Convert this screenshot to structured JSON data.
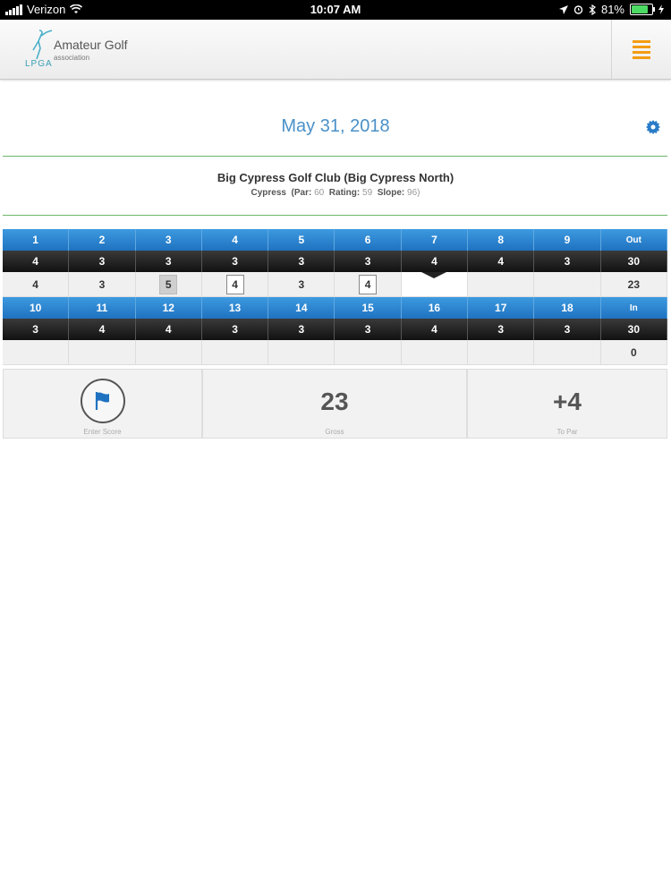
{
  "status_bar": {
    "carrier": "Verizon",
    "time": "10:07 AM",
    "battery": "81%",
    "battery_level": 0.81
  },
  "header": {
    "logo_title": "Amateur Golf",
    "logo_sub": "association",
    "logo_mark": "LPGA"
  },
  "date": "May 31, 2018",
  "course": {
    "name": "Big Cypress Golf Club (Big Cypress North)",
    "tee": "Cypress",
    "par_label": "(Par:",
    "par": "60",
    "rating_label": "Rating:",
    "rating": "59",
    "slope_label": "Slope:",
    "slope": "96)"
  },
  "front": {
    "holes": [
      "1",
      "2",
      "3",
      "4",
      "5",
      "6",
      "7",
      "8",
      "9",
      "Out"
    ],
    "par": [
      "4",
      "3",
      "3",
      "3",
      "3",
      "3",
      "4",
      "4",
      "3",
      "30"
    ],
    "score": [
      "4",
      "3",
      "5",
      "4",
      "3",
      "4",
      "",
      "",
      "",
      "23"
    ]
  },
  "back": {
    "holes": [
      "10",
      "11",
      "12",
      "13",
      "14",
      "15",
      "16",
      "17",
      "18",
      "In"
    ],
    "par": [
      "3",
      "4",
      "4",
      "3",
      "3",
      "3",
      "4",
      "3",
      "3",
      "30"
    ],
    "score": [
      "",
      "",
      "",
      "",
      "",
      "",
      "",
      "",
      "",
      "0"
    ]
  },
  "summary": {
    "enter_score_label": "Enter Score",
    "gross_value": "23",
    "gross_label": "Gross",
    "to_par_value": "+4",
    "to_par_label": "To Par"
  },
  "colors": {
    "accent_blue": "#1f72c0",
    "menu_orange": "#f39c12",
    "divider_green": "#6db56a",
    "date_blue": "#4a90c8"
  }
}
